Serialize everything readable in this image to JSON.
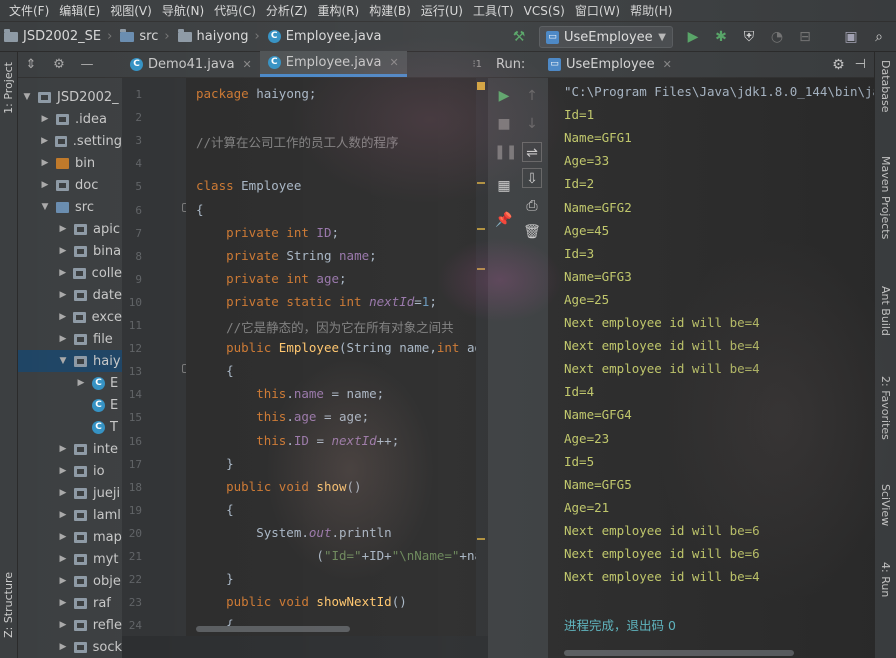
{
  "menu": [
    "文件(F)",
    "编辑(E)",
    "视图(V)",
    "导航(N)",
    "代码(C)",
    "分析(Z)",
    "重构(R)",
    "构建(B)",
    "运行(U)",
    "工具(T)",
    "VCS(S)",
    "窗口(W)",
    "帮助(H)"
  ],
  "breadcrumbs": [
    "JSD2002_SE",
    "src",
    "haiyong",
    "Employee.java"
  ],
  "run_config": "UseEmployee",
  "left_tabs": {
    "project": "1: Project",
    "structure": "Z: Structure"
  },
  "project_tree": [
    {
      "label": "JSD2002_",
      "indent": 0,
      "open": true,
      "kind": "module"
    },
    {
      "label": ".idea",
      "indent": 1,
      "open": false,
      "kind": "folder"
    },
    {
      "label": ".setting",
      "indent": 1,
      "open": false,
      "kind": "folder"
    },
    {
      "label": "bin",
      "indent": 1,
      "open": false,
      "kind": "orange"
    },
    {
      "label": "doc",
      "indent": 1,
      "open": false,
      "kind": "folder"
    },
    {
      "label": "src",
      "indent": 1,
      "open": true,
      "kind": "blue"
    },
    {
      "label": "apic",
      "indent": 2,
      "open": false,
      "kind": "pkg"
    },
    {
      "label": "bina",
      "indent": 2,
      "open": false,
      "kind": "pkg"
    },
    {
      "label": "colle",
      "indent": 2,
      "open": false,
      "kind": "pkg"
    },
    {
      "label": "date",
      "indent": 2,
      "open": false,
      "kind": "pkg"
    },
    {
      "label": "exce",
      "indent": 2,
      "open": false,
      "kind": "pkg"
    },
    {
      "label": "file",
      "indent": 2,
      "open": false,
      "kind": "pkg"
    },
    {
      "label": "haiy",
      "indent": 2,
      "open": true,
      "kind": "pkg",
      "selected": true
    },
    {
      "label": "E",
      "indent": 3,
      "open": false,
      "kind": "class"
    },
    {
      "label": "E",
      "indent": 3,
      "open": null,
      "kind": "class"
    },
    {
      "label": "T",
      "indent": 3,
      "open": null,
      "kind": "class"
    },
    {
      "label": "inte",
      "indent": 2,
      "open": false,
      "kind": "pkg"
    },
    {
      "label": "io",
      "indent": 2,
      "open": false,
      "kind": "pkg"
    },
    {
      "label": "jueji",
      "indent": 2,
      "open": false,
      "kind": "pkg"
    },
    {
      "label": "laml",
      "indent": 2,
      "open": false,
      "kind": "pkg"
    },
    {
      "label": "map",
      "indent": 2,
      "open": false,
      "kind": "pkg"
    },
    {
      "label": "myt",
      "indent": 2,
      "open": false,
      "kind": "pkg"
    },
    {
      "label": "obje",
      "indent": 2,
      "open": false,
      "kind": "pkg"
    },
    {
      "label": "raf",
      "indent": 2,
      "open": false,
      "kind": "pkg"
    },
    {
      "label": "refle",
      "indent": 2,
      "open": false,
      "kind": "pkg"
    },
    {
      "label": "sock",
      "indent": 2,
      "open": false,
      "kind": "pkg"
    }
  ],
  "editor_tabs": [
    {
      "label": "Demo41.java",
      "active": false
    },
    {
      "label": "Employee.java",
      "active": true
    }
  ],
  "line_numbers": [
    "1",
    "2",
    "3",
    "4",
    "5",
    "6",
    "7",
    "8",
    "9",
    "10",
    "11",
    "12",
    "13",
    "14",
    "15",
    "16",
    "17",
    "18",
    "19",
    "20",
    "21",
    "22",
    "23",
    "24"
  ],
  "code_lines": [
    [
      [
        "kw",
        "package "
      ],
      [
        "",
        "haiyong;"
      ]
    ],
    [],
    [
      [
        "cm",
        "//计算在公司工作的员工人数的程序"
      ]
    ],
    [],
    [
      [
        "kw",
        "class "
      ],
      [
        "",
        "Employee"
      ]
    ],
    [
      [
        "",
        "{"
      ]
    ],
    [
      [
        "",
        "    "
      ],
      [
        "kw",
        "private int "
      ],
      [
        "fld",
        "ID"
      ],
      [
        "",
        ";"
      ]
    ],
    [
      [
        "",
        "    "
      ],
      [
        "kw",
        "private "
      ],
      [
        "",
        "String "
      ],
      [
        "fld",
        "name"
      ],
      [
        "",
        ";"
      ]
    ],
    [
      [
        "",
        "    "
      ],
      [
        "kw",
        "private int "
      ],
      [
        "fld",
        "age"
      ],
      [
        "",
        ";"
      ]
    ],
    [
      [
        "",
        "    "
      ],
      [
        "kw",
        "private static int "
      ],
      [
        "fldi",
        "nextId"
      ],
      [
        "",
        "="
      ],
      [
        "num",
        "1"
      ],
      [
        "",
        ";"
      ]
    ],
    [
      [
        "",
        "    "
      ],
      [
        "cm",
        "//它是静态的，因为它在所有对象之间共"
      ]
    ],
    [
      [
        "",
        "    "
      ],
      [
        "kw",
        "public "
      ],
      [
        "mth",
        "Employee"
      ],
      [
        "",
        "(String name,"
      ],
      [
        "kw",
        "int "
      ],
      [
        "",
        "age"
      ]
    ],
    [
      [
        "",
        "    {"
      ]
    ],
    [
      [
        "",
        "        "
      ],
      [
        "kw",
        "this"
      ],
      [
        "",
        "."
      ],
      [
        "fld",
        "name"
      ],
      [
        "",
        " = name;"
      ]
    ],
    [
      [
        "",
        "        "
      ],
      [
        "kw",
        "this"
      ],
      [
        "",
        "."
      ],
      [
        "fld",
        "age"
      ],
      [
        "",
        " = age;"
      ]
    ],
    [
      [
        "",
        "        "
      ],
      [
        "kw",
        "this"
      ],
      [
        "",
        "."
      ],
      [
        "fld",
        "ID"
      ],
      [
        "",
        " = "
      ],
      [
        "fldi",
        "nextId"
      ],
      [
        "",
        "++;"
      ]
    ],
    [
      [
        "",
        "    }"
      ]
    ],
    [
      [
        "",
        "    "
      ],
      [
        "kw",
        "public void "
      ],
      [
        "mth",
        "show"
      ],
      [
        "",
        "()"
      ]
    ],
    [
      [
        "",
        "    {"
      ]
    ],
    [
      [
        "",
        "        System."
      ],
      [
        "fldi",
        "out"
      ],
      [
        "",
        ".println"
      ]
    ],
    [
      [
        "",
        "                ("
      ],
      [
        "str",
        "\"Id=\""
      ],
      [
        "",
        "+ID+"
      ],
      [
        "str",
        "\"\\nName=\""
      ],
      [
        "",
        "+nam"
      ]
    ],
    [
      [
        "",
        "    }"
      ]
    ],
    [
      [
        "",
        "    "
      ],
      [
        "kw",
        "public void "
      ],
      [
        "mth",
        "showNextId"
      ],
      [
        "",
        "()"
      ]
    ],
    [
      [
        "",
        "    {"
      ]
    ]
  ],
  "run": {
    "label": "Run:",
    "tab": "UseEmployee",
    "output": [
      "\"C:\\Program Files\\Java\\jdk1.8.0_144\\bin\\ja",
      "Id=1",
      "Name=GFG1",
      "Age=33",
      "Id=2",
      "Name=GFG2",
      "Age=45",
      "Id=3",
      "Name=GFG3",
      "Age=25",
      "Next employee id will be=4",
      "Next employee id will be=4",
      "Next employee id will be=4",
      "Id=4",
      "Name=GFG4",
      "Age=23",
      "Id=5",
      "Name=GFG5",
      "Age=21",
      "Next employee id will be=6",
      "Next employee id will be=6",
      "Next employee id will be=4",
      "",
      "进程完成，退出码 0"
    ]
  },
  "right_tabs": [
    "Database",
    "Maven Projects",
    "Ant Build",
    "2: Favorites",
    "SciView",
    "4: Run"
  ],
  "colors": {
    "keyword": "#cc7832",
    "comment": "#808080",
    "field": "#9876aa",
    "string": "#6a8759",
    "number": "#6897bb",
    "method": "#ffc66d",
    "output": "#c2c96b",
    "exit": "#5eb6c0",
    "selection": "#1f4565",
    "run_green": "#59a869"
  }
}
